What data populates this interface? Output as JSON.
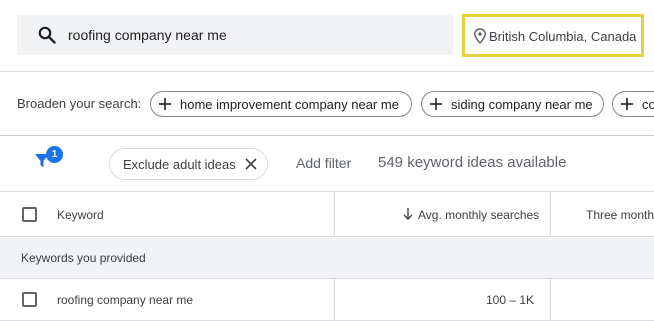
{
  "search": {
    "query": "roofing company near me",
    "location": "British Columbia, Canada"
  },
  "broaden": {
    "label": "Broaden your search:",
    "chips": [
      "home improvement company near me",
      "siding company near me",
      "co"
    ]
  },
  "filters": {
    "badge_count": "1",
    "exclude_chip": "Exclude adult ideas",
    "add_filter": "Add filter",
    "ideas_available": "549 keyword ideas available"
  },
  "table": {
    "columns": {
      "keyword": "Keyword",
      "avg_monthly_searches": "Avg. monthly searches",
      "three_month": "Three month"
    },
    "group_label": "Keywords you provided",
    "rows": [
      {
        "keyword": "roofing company near me",
        "avg_monthly_searches": "100 – 1K"
      }
    ]
  },
  "colors": {
    "location_highlight": "#e6d23d",
    "badge": "#1a73e8",
    "filter_icon": "#1a73e8"
  },
  "icons": {
    "search": "search-icon",
    "location": "location-pin-icon",
    "add": "plus-icon",
    "filter": "filter-icon",
    "close": "close-icon",
    "sort": "arrow-down-icon"
  }
}
